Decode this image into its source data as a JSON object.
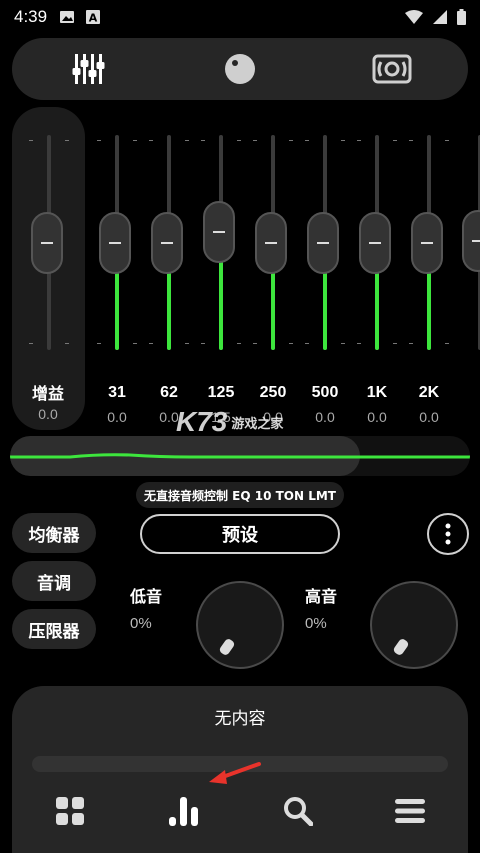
{
  "status_bar": {
    "time": "4:39"
  },
  "top_tabs": [
    {
      "icon": "equalizer-sliders-icon"
    },
    {
      "icon": "knob-icon"
    },
    {
      "icon": "speaker-icon"
    }
  ],
  "preamp": {
    "label": "增益",
    "value": "0.0",
    "level": 0.5
  },
  "bands": [
    {
      "freq": "31",
      "value": "0.0",
      "level": 0.5
    },
    {
      "freq": "62",
      "value": "0.0",
      "level": 0.5
    },
    {
      "freq": "125",
      "value": "1.5",
      "level": 0.57
    },
    {
      "freq": "250",
      "value": "0.0",
      "level": 0.5
    },
    {
      "freq": "500",
      "value": "0.0",
      "level": 0.5
    },
    {
      "freq": "1K",
      "value": "0.0",
      "level": 0.5
    },
    {
      "freq": "2K",
      "value": "0.0",
      "level": 0.5
    }
  ],
  "watermark": {
    "logo": "K73",
    "text": "游戏之家"
  },
  "preset_status": "无直接音频控制 EQ 10 TON LMT",
  "side_buttons": [
    "均衡器",
    "音调",
    "压限器"
  ],
  "preset_button": "预设",
  "bass": {
    "label": "低音",
    "value": "0%"
  },
  "treble": {
    "label": "高音",
    "value": "0%"
  },
  "player": {
    "now_playing": "无内容"
  },
  "bottom_nav": [
    {
      "icon": "grid-icon"
    },
    {
      "icon": "bars-icon"
    },
    {
      "icon": "search-icon"
    },
    {
      "icon": "menu-icon"
    }
  ],
  "colors": {
    "accent": "#3de63d",
    "panel": "#262626"
  }
}
